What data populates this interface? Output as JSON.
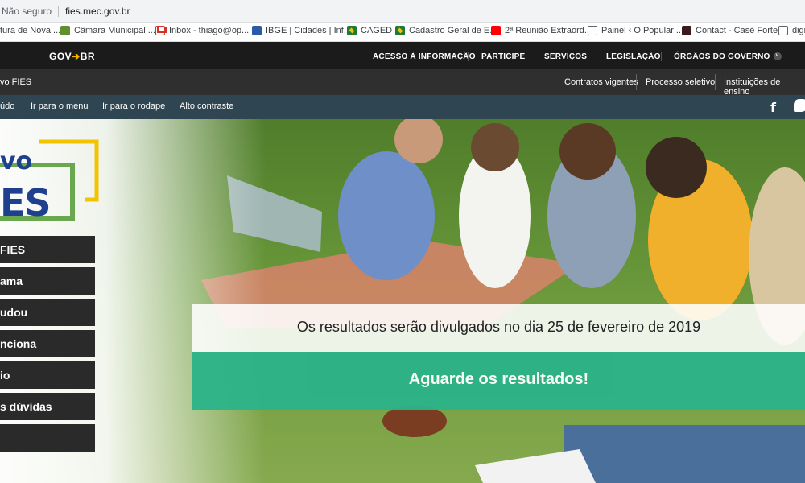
{
  "browser": {
    "security_label": "Não seguro",
    "url": "fies.mec.gov.br"
  },
  "bookmarks": [
    {
      "label": "tura de Nova ..."
    },
    {
      "label": "Câmara Municipal ..."
    },
    {
      "label": "Inbox - thiago@op..."
    },
    {
      "label": "IBGE | Cidades | Inf..."
    },
    {
      "label": "CAGED"
    },
    {
      "label": "Cadastro Geral de E..."
    },
    {
      "label": "2ª Reunião Extraord..."
    },
    {
      "label": "Painel ‹ O Popular ..."
    },
    {
      "label": "Contact - Casé Fortes"
    },
    {
      "label": "digi"
    }
  ],
  "govbar": {
    "logo_gov": "GOV",
    "logo_arrow": "➔",
    "logo_br": "BR",
    "nav": [
      "ACESSO À INFORMAÇÃO",
      "PARTICIPE",
      "SERVIÇOS",
      "LEGISLAÇÃO",
      "ÓRGÃOS DO GOVERNO"
    ],
    "chevron": "˅"
  },
  "sitebar": {
    "title": "vo FIES",
    "links": [
      "Contratos vigentes",
      "Processo seletivo",
      "Instituições de ensino"
    ]
  },
  "accessibility": {
    "links": [
      "údo",
      "Ir para o menu",
      "Ir para o rodape",
      "Alto contraste"
    ],
    "facebook_glyph": "f"
  },
  "logo": {
    "line1": "vo",
    "line2": "ES"
  },
  "sidemenu": {
    "items": [
      "FIES",
      "ama",
      "udou",
      "nciona",
      "io",
      "s dúvidas",
      ""
    ]
  },
  "hero": {
    "announcement": "Os resultados serão divulgados no dia 25 de fevereiro de 2019",
    "cta": "Aguarde os resultados!"
  },
  "colors": {
    "gov_bar": "#1b1b1b",
    "site_bar": "#2f2f2f",
    "access_bar": "#2f4652",
    "cta_green": "#2bb389",
    "logo_blue": "#1f3f8f",
    "logo_yellow": "#f2c300",
    "logo_green": "#6aa84f"
  }
}
